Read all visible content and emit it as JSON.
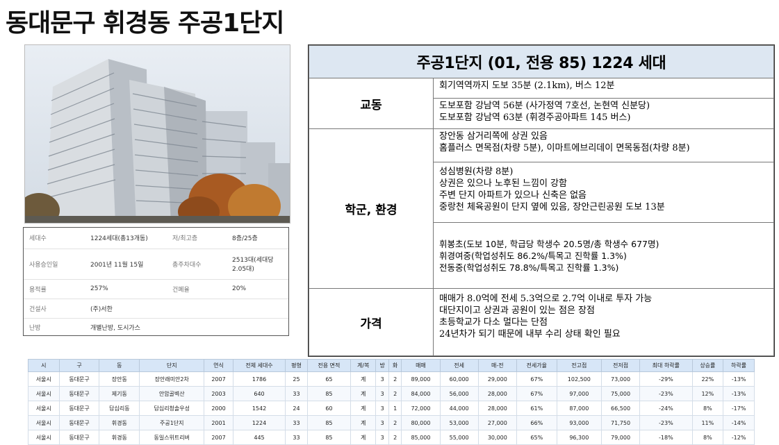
{
  "title": "동대문구 휘경동 주공1단지",
  "icons": {
    "photo": "apartment-photo"
  },
  "spec": {
    "rows": [
      [
        "세대수",
        "1224세대(총13개동)",
        "저/최고층",
        "8층/25층"
      ],
      [
        "사용승인일",
        "2001년 11월 15일",
        "총주차대수",
        "2513대(세대당 2.05대)"
      ],
      [
        "용적률",
        "257%",
        "건폐율",
        "20%"
      ],
      [
        "건설사",
        "(주)서한",
        "",
        ""
      ],
      [
        "난방",
        "개별난방, 도시가스",
        "",
        ""
      ]
    ]
  },
  "info": {
    "header": "주공1단지 (01, 전용 85) 1224 세대",
    "sections": {
      "transport": {
        "label": "교동",
        "cells": [
          [
            "회기역역까지 도보 35분 (2.1km), 버스 12분"
          ],
          [
            "도보포함 강남역 56분 (사가정역 7호선, 논현역 신분당)",
            "도보포함 강남역 63분 (휘경주공아파트 145 버스)"
          ]
        ]
      },
      "school_env": {
        "label": "학군, 환경",
        "cells": [
          [
            "장안동 삼거리쪽에 상권 있음",
            "홈플러스 면목점(차량 5분), 이마트에브리데이 면목동점(차량 8분)"
          ],
          [
            "성심병원(차량 8분)",
            "상권은 있으나 노후된 느낌이 강함",
            "주변 단지 아파트가 있으나 신축은 없음",
            "중랑천 체육공원이 단지 옆에 있음, 장안근린공원 도보 13분"
          ],
          [
            "휘봉초(도보 10분, 학급당 학생수 20.5명/총 학생수 677명)",
            "휘경여중(학업성취도 86.2%/특목고 진학률 1.3%)",
            "전동중(학업성취도 78.8%/특목고 진학률 1.3%)"
          ]
        ]
      },
      "price": {
        "label": "가격",
        "cells": [
          [
            "매매가 8.0억에 전세 5.3억으로 2.7억 이내로 투자 가능",
            "대단지이고 상권과 공원이 있는 점은 장점",
            "초등학교가 다소 멀다는 단점",
            "24년차가 되기 때문에 내부 수리 상태 확인 필요"
          ]
        ]
      }
    }
  },
  "compare": {
    "headers": [
      "시",
      "구",
      "동",
      "단지",
      "연식",
      "전체 세대수",
      "평형",
      "전용 면적",
      "계/복",
      "방",
      "화",
      "매매",
      "전세",
      "매-전",
      "전세가율",
      "전고점",
      "전저점",
      "최대 하락률",
      "상승률",
      "하락률"
    ],
    "rows": [
      [
        "서울시",
        "동대문구",
        "장안동",
        "장안래미안2차",
        "2007",
        "1786",
        "25",
        "65",
        "계",
        "3",
        "2",
        "89,000",
        "60,000",
        "29,000",
        "67%",
        "102,500",
        "73,000",
        "-29%",
        "22%",
        "-13%"
      ],
      [
        "서울시",
        "동대문구",
        "제기동",
        "안암골벽산",
        "2003",
        "640",
        "33",
        "85",
        "계",
        "3",
        "2",
        "84,000",
        "56,000",
        "28,000",
        "67%",
        "97,000",
        "75,000",
        "-23%",
        "12%",
        "-13%"
      ],
      [
        "서울시",
        "동대문구",
        "답십리동",
        "답십리청솔우성",
        "2000",
        "1542",
        "24",
        "60",
        "계",
        "3",
        "1",
        "72,000",
        "44,000",
        "28,000",
        "61%",
        "87,000",
        "66,500",
        "-24%",
        "8%",
        "-17%"
      ],
      [
        "서울시",
        "동대문구",
        "휘경동",
        "주공1단지",
        "2001",
        "1224",
        "33",
        "85",
        "계",
        "3",
        "2",
        "80,000",
        "53,000",
        "27,000",
        "66%",
        "93,000",
        "71,750",
        "-23%",
        "11%",
        "-14%"
      ],
      [
        "서울시",
        "동대문구",
        "휘경동",
        "동일스위트리버",
        "2007",
        "445",
        "33",
        "85",
        "계",
        "3",
        "2",
        "85,000",
        "55,000",
        "30,000",
        "65%",
        "96,300",
        "79,000",
        "-18%",
        "8%",
        "-12%"
      ]
    ]
  }
}
